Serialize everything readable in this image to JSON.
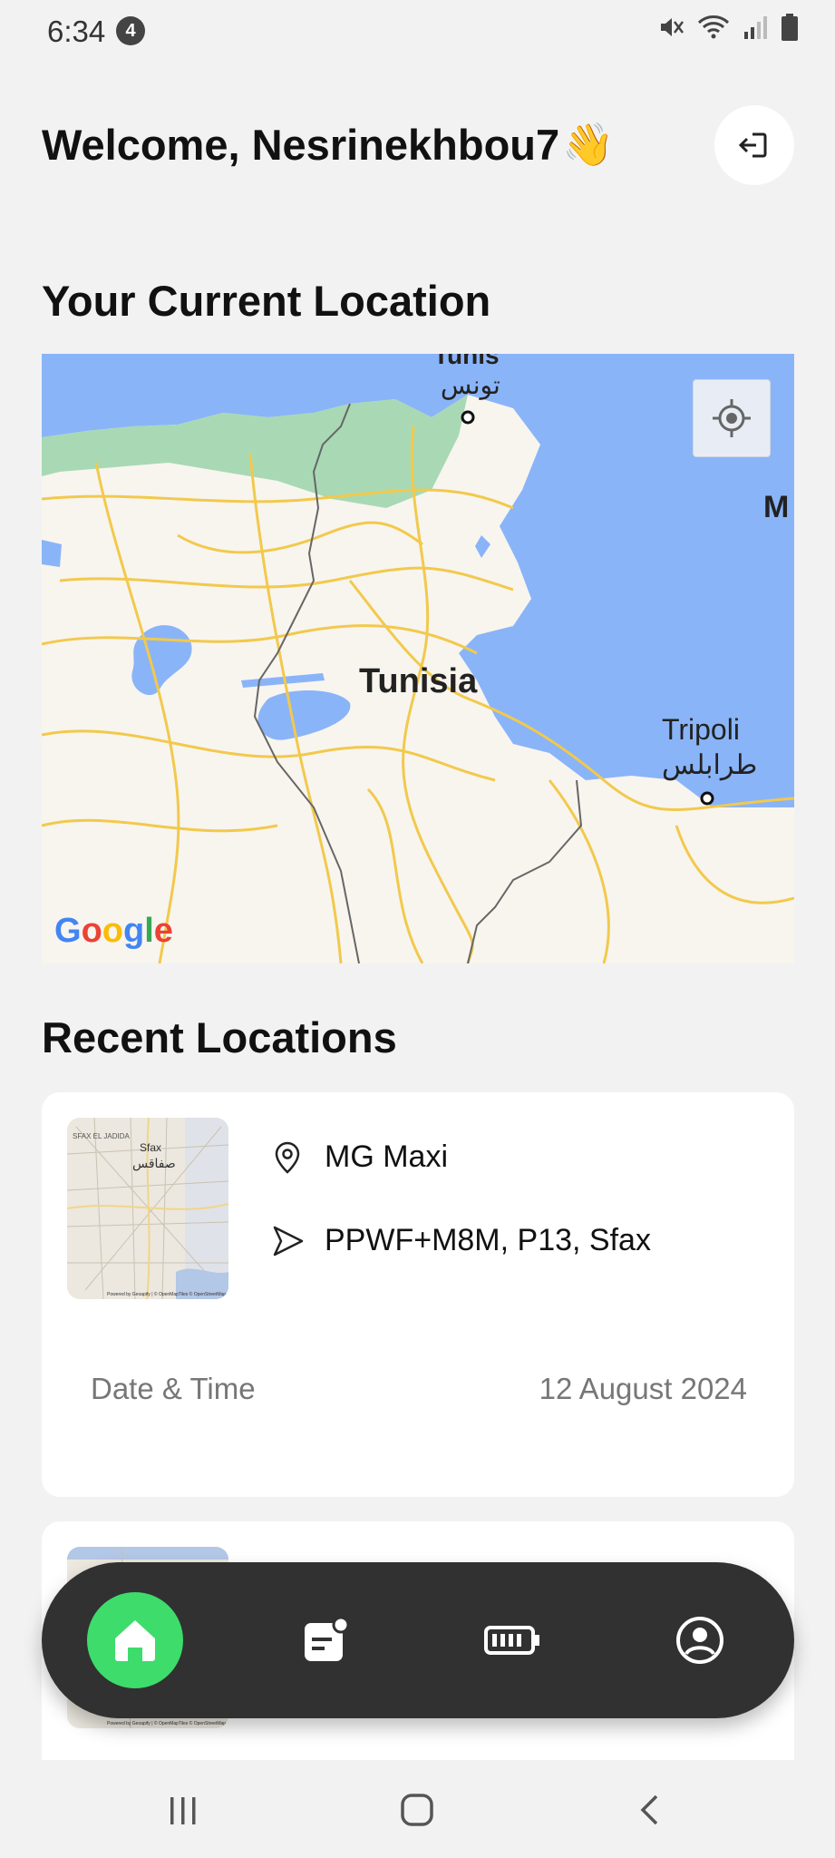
{
  "status_bar": {
    "time": "6:34",
    "notification_count": "4",
    "icons": [
      "mute-icon",
      "wifi-icon",
      "signal-icon",
      "battery-icon"
    ]
  },
  "header": {
    "welcome": "Welcome, Nesrinekhbou7",
    "wave_emoji": "👋",
    "logout_icon": "logout-icon"
  },
  "current_location": {
    "title": "Your Current Location",
    "map_labels": {
      "tunis_en": "Tunis",
      "tunis_ar": "تونس",
      "country": "Tunisia",
      "tripoli_en": "Tripoli",
      "tripoli_ar": "طرابلس",
      "edge_label": "M"
    },
    "attribution": "Google",
    "locate_icon": "my-location-icon"
  },
  "recent_locations": {
    "title": "Recent Locations",
    "items": [
      {
        "name": "MG Maxi",
        "address": "PPWF+M8M, P13, Sfax",
        "date_label": "Date & Time",
        "date_value": "12 August 2024",
        "thumb_labels": {
          "district": "SFAX EL JADIDA",
          "city": "Sfax",
          "city_ar": "صفاقس",
          "credit": "Powered by Geoapify | © OpenMapTiles © OpenStreetMap"
        }
      },
      {
        "thumb_labels": {
          "credit": "Powered by Geoapify | © OpenMapTiles © OpenStreetMap"
        }
      }
    ]
  },
  "bottom_nav": {
    "items": [
      "home-icon",
      "reports-icon",
      "battery-icon",
      "profile-icon"
    ],
    "active": "home-icon",
    "active_color": "#3ddc6b"
  },
  "system_nav": [
    "recents-icon",
    "home-circle-icon",
    "back-icon"
  ]
}
